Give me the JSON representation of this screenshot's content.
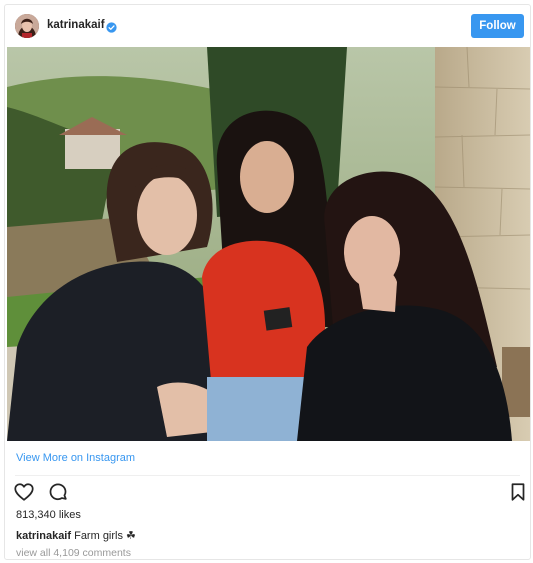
{
  "colors": {
    "accent": "#3897f0",
    "text": "#262626",
    "muted": "#999999",
    "border": "#e6e6e6"
  },
  "header": {
    "username": "katrinakaif",
    "verified_icon": "verified-badge-icon",
    "follow_label": "Follow"
  },
  "post": {
    "image_alt_icon": "photo",
    "view_more_label": "View More on Instagram"
  },
  "actions": {
    "like_icon": "heart-icon",
    "comment_icon": "comment-icon",
    "save_icon": "bookmark-icon"
  },
  "stats": {
    "likes_text": "813,340 likes"
  },
  "caption": {
    "user": "katrinakaif",
    "text": "Farm girls ☘"
  },
  "comments_link": "view all 4,109 comments"
}
